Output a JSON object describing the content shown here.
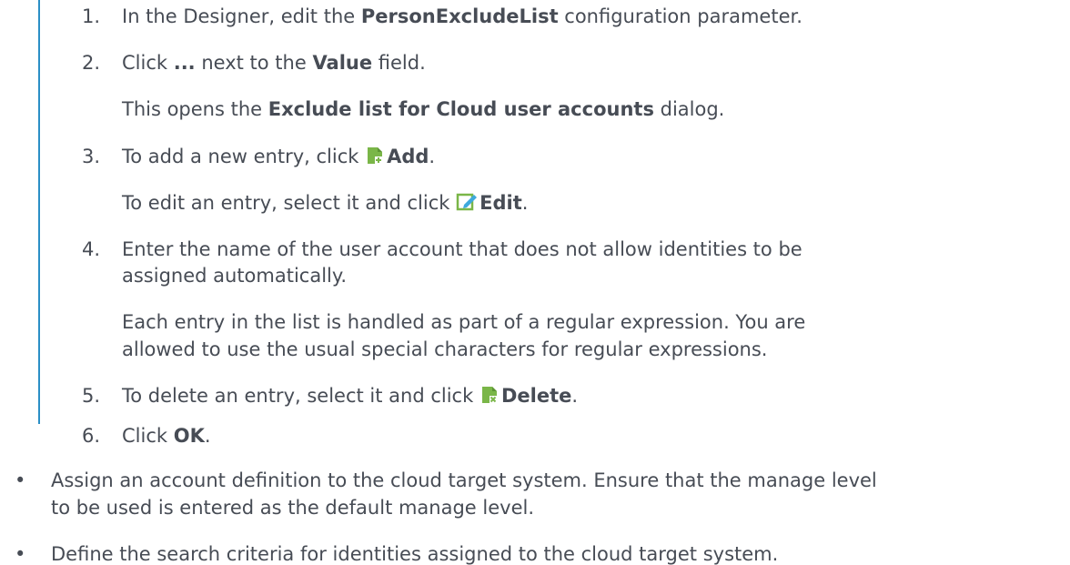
{
  "steps": [
    {
      "num": "1.",
      "pre": "In the Designer, edit the ",
      "bold": "PersonExcludeList",
      "post": " configuration parameter."
    },
    {
      "num": "2.",
      "pre": "Click ",
      "bold1": "...",
      "mid": " next to the ",
      "bold2": "Value",
      "post": " field."
    },
    {
      "num": "3.",
      "pre": "To add a new entry, click ",
      "bold": "Add",
      "post": "."
    },
    {
      "num": "4.",
      "text1": "Enter the name of the user account that does not allow identities to be",
      "text2": "assigned automatically."
    },
    {
      "num": "5.",
      "pre": "To delete an entry, select it and click ",
      "bold": "Delete",
      "post": "."
    },
    {
      "num": "6.",
      "pre": "Click ",
      "bold": "OK",
      "post": "."
    }
  ],
  "step2_note": {
    "pre": "This opens the ",
    "bold": "Exclude list for Cloud user accounts",
    "post": " dialog."
  },
  "step3_note": {
    "pre": "To edit an entry, select it and click",
    "bold": "Edit",
    "post": "."
  },
  "step4_note": {
    "line1": "Each entry in the list is handled as part of a regular expression. You are",
    "line2": "allowed to use the usual special characters for regular expressions."
  },
  "bullets": [
    {
      "bullet": "•",
      "line1": "Assign an account definition to the cloud target system. Ensure that the manage level",
      "line2": "to be used is entered as the default manage level."
    },
    {
      "bullet": "•",
      "line1": "Define the search criteria for identities assigned to the cloud target system.",
      "line2": ""
    }
  ],
  "icons": {
    "add": "add-icon",
    "edit": "edit-icon",
    "delete": "delete-icon"
  },
  "colors": {
    "text": "#474c55",
    "bar": "#2b8fc6",
    "icon_green": "#7ab648",
    "icon_edit": "#3fa9dc"
  }
}
